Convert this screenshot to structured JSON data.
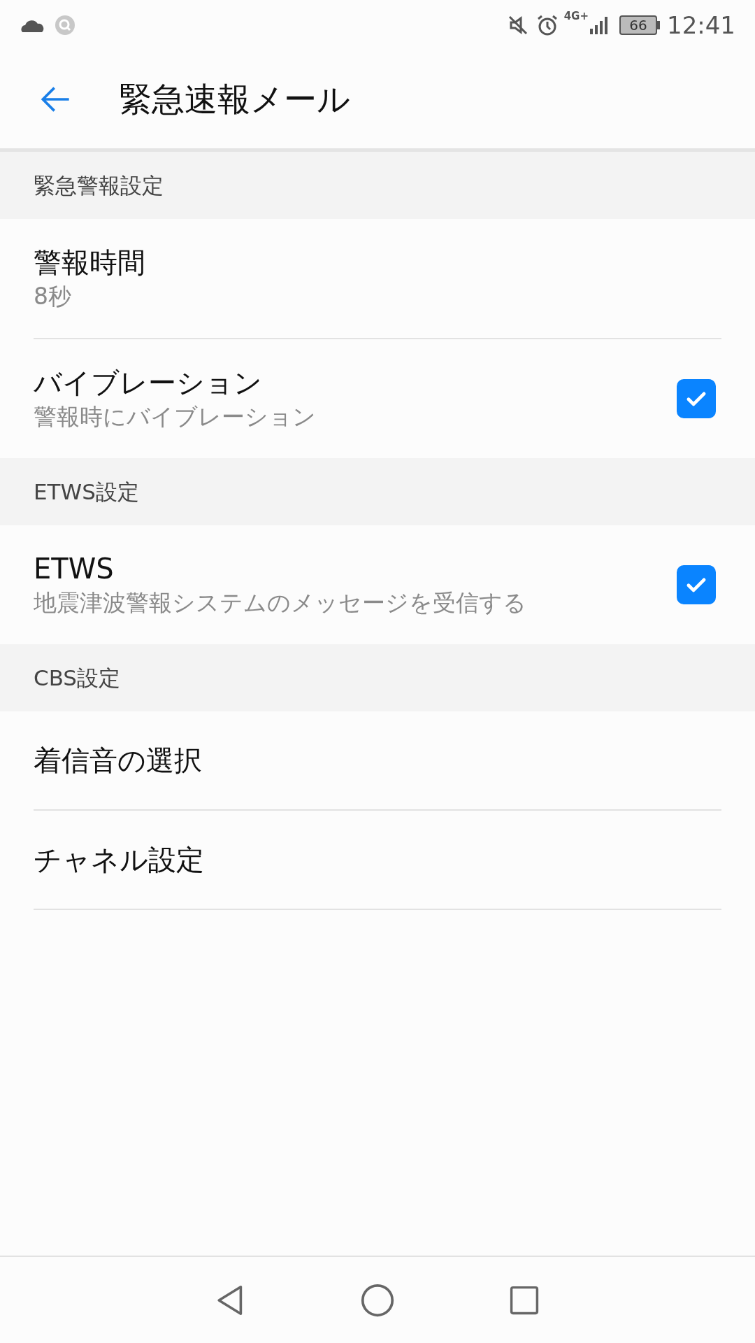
{
  "status_bar": {
    "network": "4G+",
    "battery": "66",
    "time": "12:41"
  },
  "app_bar": {
    "title": "緊急速報メール"
  },
  "sections": [
    {
      "header": "緊急警報設定",
      "items": [
        {
          "kind": "text",
          "title": "警報時間",
          "subtitle": "8秒"
        },
        {
          "kind": "checkbox",
          "title": "バイブレーション",
          "subtitle": "警報時にバイブレーション",
          "checked": true
        }
      ]
    },
    {
      "header": "ETWS設定",
      "items": [
        {
          "kind": "checkbox",
          "title": "ETWS",
          "subtitle": "地震津波警報システムのメッセージを受信する",
          "checked": true
        }
      ]
    },
    {
      "header": "CBS設定",
      "items": [
        {
          "kind": "link",
          "title": "着信音の選択"
        },
        {
          "kind": "link",
          "title": "チャネル設定"
        }
      ]
    }
  ]
}
